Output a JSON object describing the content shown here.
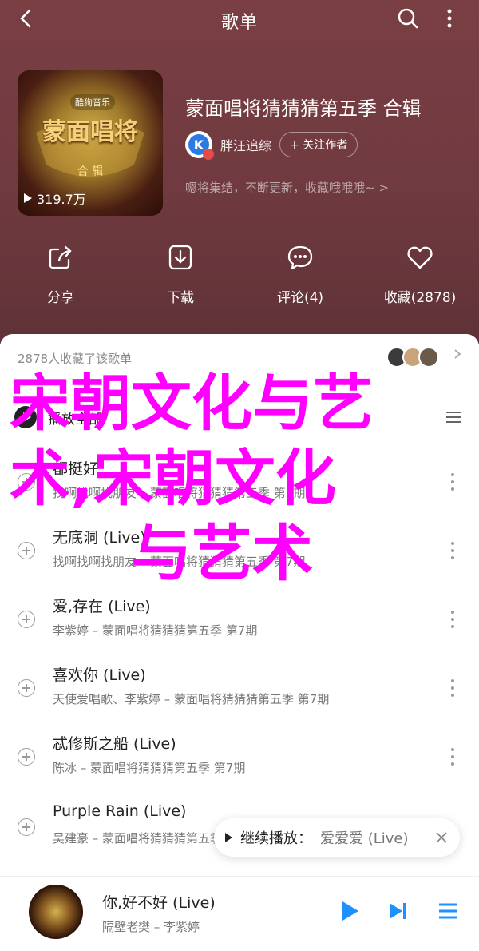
{
  "header": {
    "title": "歌单"
  },
  "cover": {
    "brand": "酷狗音乐",
    "logo_text": "蒙面唱将",
    "collection": "合 辑",
    "plays": "319.7万"
  },
  "playlist": {
    "title": "蒙面唱将猜猜猜第五季 合辑",
    "owner_name": "胖汪追综",
    "follow_label": "+ 关注作者",
    "description": "嗯将集结，不断更新，收藏哦哦哦~ >"
  },
  "actions": [
    {
      "label": "分享"
    },
    {
      "label": "下载"
    },
    {
      "label": "评论(4)"
    },
    {
      "label": "收藏(2878)"
    }
  ],
  "favorites": {
    "text": "2878人收藏了该歌单"
  },
  "play_all": {
    "label": "播放全部"
  },
  "songs": [
    {
      "title": "都挺好",
      "artist": "找啊找啊找朋友 – 蒙面唱将猜猜猜第五季 第7期"
    },
    {
      "title": "无底洞 (Live)",
      "artist": "找啊找啊找朋友 – 蒙面唱将猜猜猜第五季 第7期"
    },
    {
      "title": "爱,存在 (Live)",
      "artist": "李紫婷 – 蒙面唱将猜猜猜第五季 第7期"
    },
    {
      "title": "喜欢你 (Live)",
      "artist": "天使爱唱歌、李紫婷 – 蒙面唱将猜猜猜第五季 第7期"
    },
    {
      "title": "忒修斯之船 (Live)",
      "artist": "陈冰 – 蒙面唱将猜猜猜第五季 第7期"
    },
    {
      "title": "Purple Rain (Live)",
      "artist": "吴建豪 – 蒙面唱将猜猜猜第五季 第7期"
    }
  ],
  "continue_play": {
    "label": "继续播放：",
    "song": "爱爱爱 (Live)"
  },
  "now_playing": {
    "title": "你,好不好 (Live)",
    "artist": "隔壁老樊 – 李紫婷"
  },
  "overlay_text": {
    "line1": "宋朝文化与艺",
    "line2": "术,宋朝文化",
    "line3": "与艺术"
  },
  "colors": {
    "hero_bg": "#7a3f43",
    "overlay": "#ff00ff",
    "play_accent": "#1e90ff"
  },
  "icons": {
    "back": "chevron-left-icon",
    "search": "search-icon",
    "more": "more-icon",
    "share": "share-icon",
    "download": "download-icon",
    "comment": "comment-icon",
    "favorite": "heart-icon"
  }
}
